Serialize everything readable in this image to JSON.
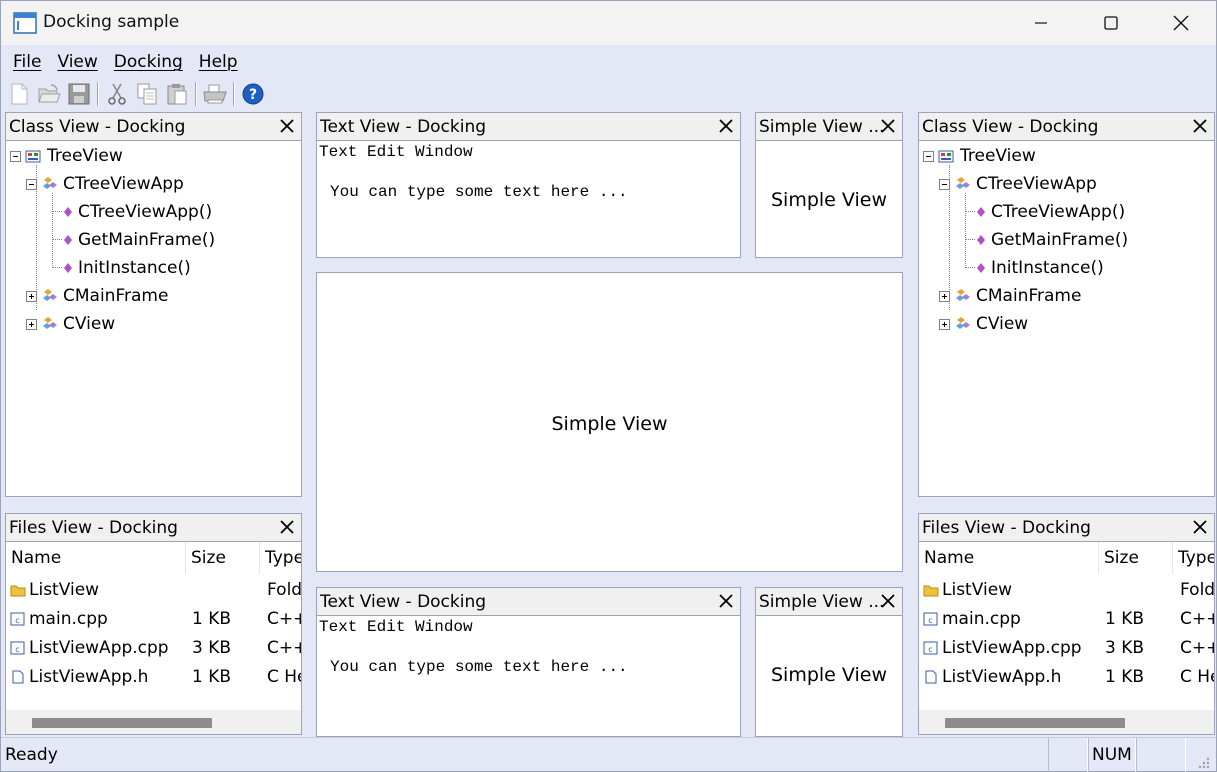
{
  "window": {
    "title": "Docking sample"
  },
  "menu": {
    "file": "File",
    "view": "View",
    "docking": "Docking",
    "help": "Help"
  },
  "toolbar": {
    "icons": [
      "new-file-icon",
      "open-folder-icon",
      "save-icon",
      "cut-icon",
      "copy-icon",
      "paste-icon",
      "print-icon",
      "help-icon"
    ]
  },
  "class_view": {
    "title": "Class View - Docking",
    "root": "TreeView",
    "app_class": "CTreeViewApp",
    "members": [
      "CTreeViewApp()",
      "GetMainFrame()",
      "InitInstance()"
    ],
    "main_frame": "CMainFrame",
    "view": "CView"
  },
  "files_view": {
    "title": "Files View - Docking",
    "columns": [
      "Name",
      "Size",
      "Type"
    ],
    "rows": [
      {
        "name": "ListView",
        "size": "",
        "type": "Fold"
      },
      {
        "name": "main.cpp",
        "size": "1 KB",
        "type": "C++"
      },
      {
        "name": "ListViewApp.cpp",
        "size": "3 KB",
        "type": "C++"
      },
      {
        "name": "ListViewApp.h",
        "size": "1 KB",
        "type": "C He"
      }
    ]
  },
  "text_view": {
    "title": "Text View - Docking",
    "line1": "Text Edit Window",
    "line2": "You can type some text here ..."
  },
  "simple_view": {
    "title": "Simple View ...",
    "body": "Simple View"
  },
  "center_view": {
    "body": "Simple View"
  },
  "status": {
    "text": "Ready",
    "num": "NUM"
  },
  "colors": {
    "background": "#e4e7f5",
    "pane_header": "#f0f0f0",
    "border": "#9aa3b8"
  }
}
